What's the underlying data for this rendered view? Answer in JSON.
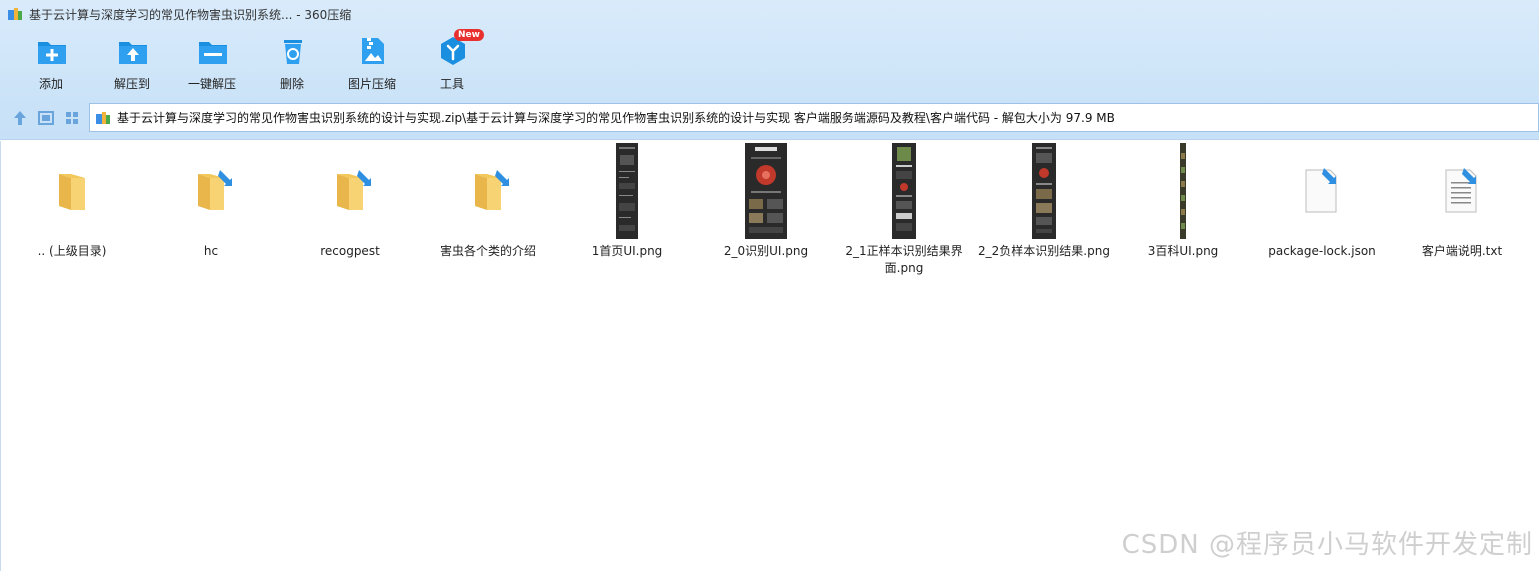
{
  "window": {
    "title": "基于云计算与深度学习的常见作物害虫识别系统... - 360压缩"
  },
  "toolbar": {
    "add": "添加",
    "extract_to": "解压到",
    "one_click_extract": "一键解压",
    "delete": "删除",
    "image_compress": "图片压缩",
    "tools": "工具",
    "tools_badge": "New"
  },
  "address": {
    "path": "基于云计算与深度学习的常见作物害虫识别系统的设计与实现.zip\\基于云计算与深度学习的常见作物害虫识别系统的设计与实现 客户端服务端源码及教程\\客户端代码 - 解包大小为 97.9 MB"
  },
  "files": [
    {
      "name": ".. (上级目录)",
      "kind": "parent-folder"
    },
    {
      "name": "hc",
      "kind": "folder"
    },
    {
      "name": "recogpest",
      "kind": "folder"
    },
    {
      "name": "害虫各个类的介绍",
      "kind": "folder"
    },
    {
      "name": "1首页UI.png",
      "kind": "image"
    },
    {
      "name": "2_0识别UI.png",
      "kind": "image"
    },
    {
      "name": "2_1正样本识别结果界面.png",
      "kind": "image"
    },
    {
      "name": "2_2负样本识别结果.png",
      "kind": "image"
    },
    {
      "name": "3百科UI.png",
      "kind": "image"
    },
    {
      "name": "package-lock.json",
      "kind": "file"
    },
    {
      "name": "客户端说明.txt",
      "kind": "text"
    }
  ],
  "watermark": "CSDN @程序员小马软件开发定制",
  "colors": {
    "accent": "#1a8fe0",
    "folder": "#f3c85a",
    "badge": "#e8302f"
  }
}
